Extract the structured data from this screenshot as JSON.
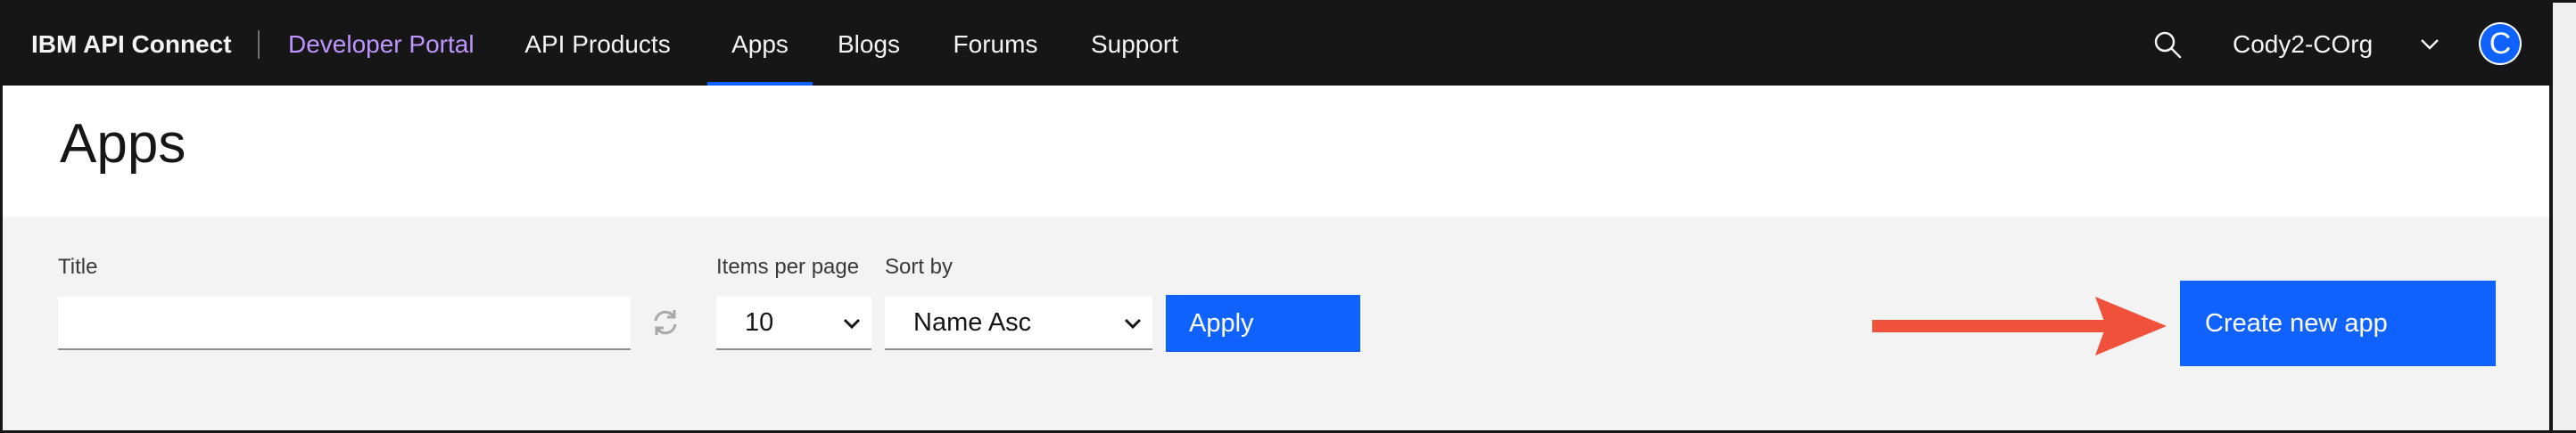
{
  "nav": {
    "brand": "IBM API Connect",
    "portal": "Developer Portal",
    "items": [
      {
        "label": "API Products",
        "active": false
      },
      {
        "label": "Apps",
        "active": true
      },
      {
        "label": "Blogs",
        "active": false
      },
      {
        "label": "Forums",
        "active": false
      },
      {
        "label": "Support",
        "active": false
      }
    ],
    "org": "Cody2-COrg",
    "avatar_initial": "C",
    "icons": {
      "search": "search-icon",
      "org_menu": "chevron-down-icon"
    }
  },
  "page": {
    "title": "Apps"
  },
  "filters": {
    "title_label": "Title",
    "title_value": "",
    "items_per_page_label": "Items per page",
    "items_per_page_value": "10",
    "sort_label": "Sort by",
    "sort_value": "Name Asc",
    "apply_label": "Apply",
    "reset_icon": "refresh-icon"
  },
  "actions": {
    "create_label": "Create new app"
  },
  "annotation": {
    "arrow_color": "#f0513a"
  },
  "colors": {
    "accent": "#0f62fe",
    "nav_bg": "#161616",
    "portal_link": "#be95ff"
  }
}
